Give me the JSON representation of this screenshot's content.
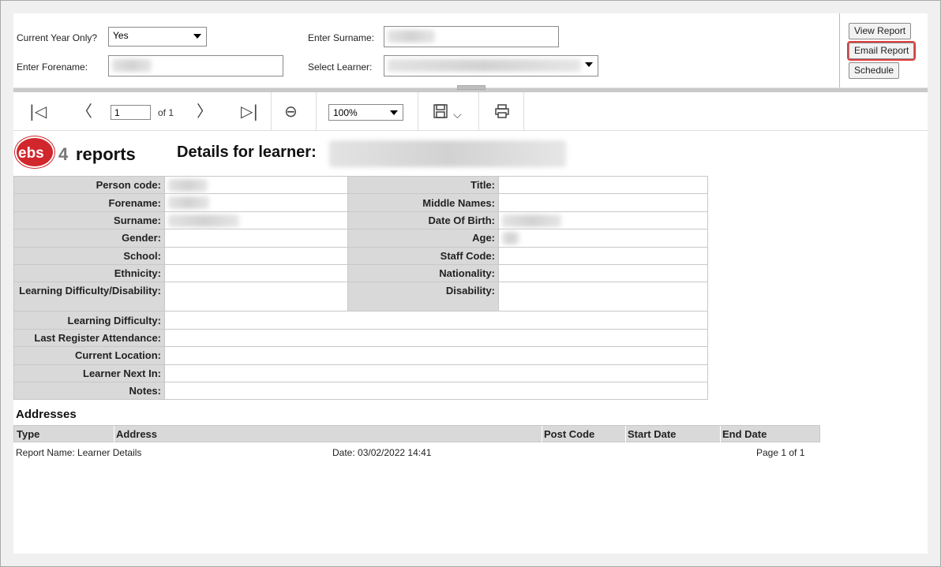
{
  "params": {
    "current_year_label": "Current Year Only?",
    "current_year_value": "Yes",
    "forename_label": "Enter Forename:",
    "forename_value": "",
    "surname_label": "Enter Surname:",
    "surname_value": "",
    "learner_label": "Select Learner:",
    "learner_value": ""
  },
  "buttons": {
    "view_report": "View Report",
    "email_report": "Email Report",
    "schedule": "Schedule"
  },
  "toolbar": {
    "page_value": "1",
    "of_label": "of 1",
    "zoom_value": "100%",
    "icons": [
      "first-page-icon",
      "previous-page-icon",
      "next-page-icon",
      "last-page-icon",
      "back-icon",
      "save-icon",
      "print-icon"
    ]
  },
  "report": {
    "logo_text": "ebs",
    "logo_4": "4",
    "logo_reports": "reports",
    "title": "Details for learner:",
    "labels": {
      "person_code": "Person code:",
      "forename": "Forename:",
      "surname": "Surname:",
      "gender": "Gender:",
      "school": "School:",
      "ethnicity": "Ethnicity:",
      "ldd": "Learning Difficulty/Disability:",
      "title": "Title:",
      "middle_names": "Middle Names:",
      "dob": "Date Of Birth:",
      "age": "Age:",
      "staff_code": "Staff Code:",
      "nationality": "Nationality:",
      "disability": "Disability:",
      "learning_difficulty": "Learning Difficulty:",
      "last_register": "Last Register Attendance:",
      "current_location": "Current Location:",
      "learner_next_in": "Learner Next In:",
      "notes": "Notes:"
    },
    "addresses_title": "Addresses",
    "address_columns": [
      "Type",
      "Address",
      "Post Code",
      "Start Date",
      "End Date"
    ],
    "footer": {
      "report_name": "Report Name: Learner Details",
      "date": "Date: 03/02/2022 14:41",
      "page": "Page 1 of 1"
    }
  },
  "colors": {
    "label_bg": "#d9d9d9",
    "highlight": "#e03c3c",
    "logo_red": "#d0262c"
  }
}
